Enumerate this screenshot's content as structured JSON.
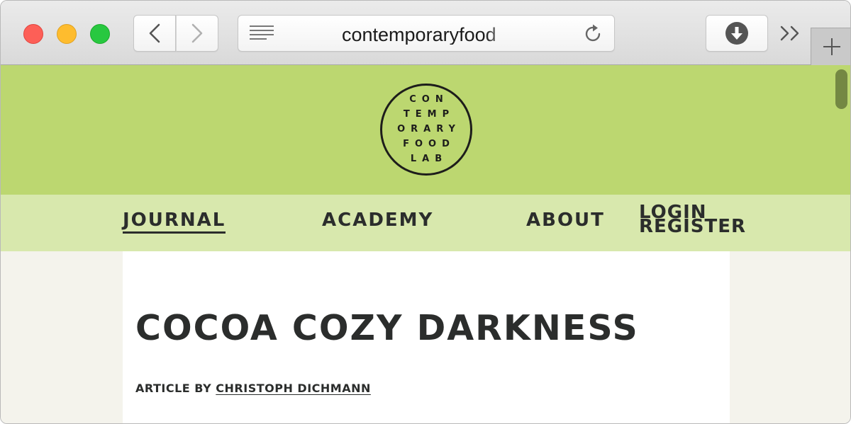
{
  "browser": {
    "address": "contemporaryfood",
    "icons": {
      "back": "chevron-left-icon",
      "forward": "chevron-right-icon",
      "reader": "reader-lines-icon",
      "reload": "reload-icon",
      "download": "download-icon",
      "more": "chevron-double-right-icon",
      "new_tab": "plus-icon"
    }
  },
  "site": {
    "logo_lines": [
      "CON",
      "TEMP",
      "ORARY",
      "FOOD",
      "LAB"
    ],
    "nav": {
      "journal": "JOURNAL",
      "academy": "ACADEMY",
      "about": "ABOUT",
      "login": "LOGIN",
      "register": "REGISTER"
    },
    "colors": {
      "hero_green": "#bcd770",
      "nav_green": "#d8e8ad",
      "text_dark": "#2b2d2c"
    }
  },
  "article": {
    "title": "COCOA COZY DARKNESS",
    "byline_prefix": "ARTICLE BY",
    "author": "CHRISTOPH DICHMANN"
  }
}
